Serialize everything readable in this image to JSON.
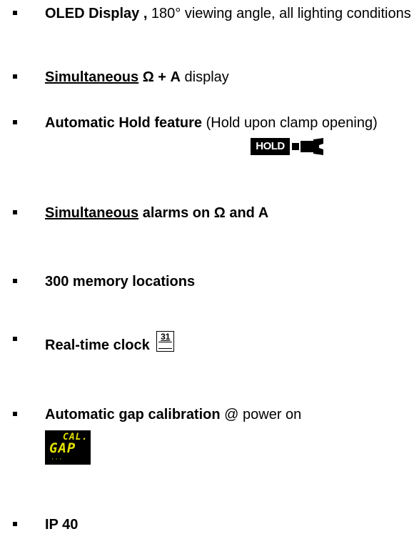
{
  "items": [
    {
      "bold": "OLED Display ,",
      "rest": " 180° viewing angle, all lighting conditions"
    },
    {
      "underlined": "Simultaneous",
      "bold": " Ω + A",
      "rest": " display"
    },
    {
      "bold": "Automatic Hold feature",
      "rest": " (Hold upon clamp opening)",
      "icon_label": "HOLD"
    },
    {
      "underlined": "Simultaneous",
      "bold": " alarms on Ω and A"
    },
    {
      "bold": "300 memory locations"
    },
    {
      "bold": "Real-time clock",
      "icon_label": "31"
    },
    {
      "bold": "Automatic gap calibration",
      "rest": " @ power on",
      "icon_top": "CAL.",
      "icon_bottom": "GAP"
    },
    {
      "bold": "IP 40"
    }
  ],
  "icons": {
    "hold": "hold-wrench-icon",
    "calendar": "calendar-icon",
    "gap_display": "cal-gap-display-icon"
  },
  "colors": {
    "text": "#000000",
    "display_bg": "#000000",
    "display_text": "#e2e200"
  }
}
